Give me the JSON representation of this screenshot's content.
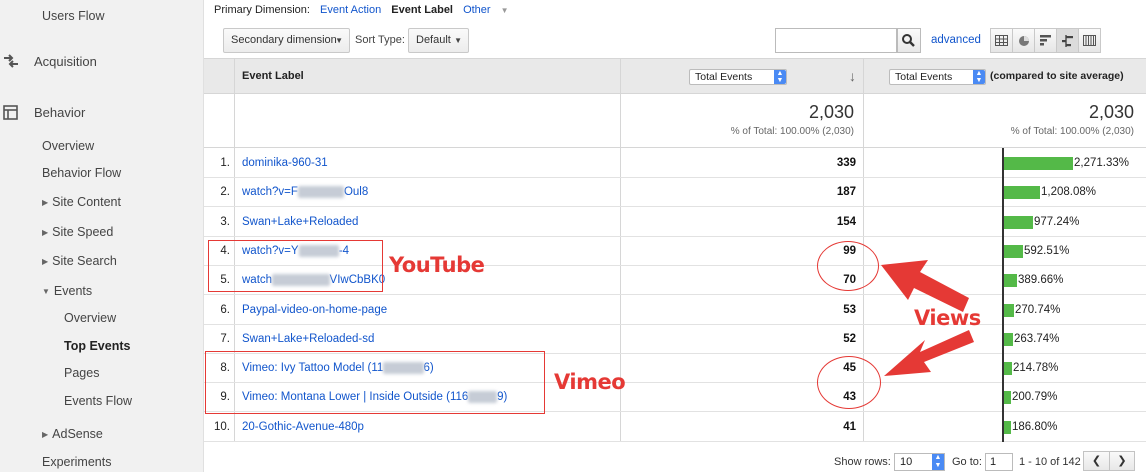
{
  "sidebar": {
    "users_flow": "Users Flow",
    "acquisition": "Acquisition",
    "behavior": "Behavior",
    "overview": "Overview",
    "behavior_flow": "Behavior Flow",
    "site_content": "Site Content",
    "site_speed": "Site Speed",
    "site_search": "Site Search",
    "events": "Events",
    "events_overview": "Overview",
    "top_events": "Top Events",
    "pages": "Pages",
    "events_flow": "Events Flow",
    "adsense": "AdSense",
    "experiments": "Experiments"
  },
  "dimensions": {
    "primary_label": "Primary Dimension:",
    "event_action": "Event Action",
    "event_label": "Event Label",
    "other": "Other"
  },
  "toolbar": {
    "secondary_dimension": "Secondary dimension",
    "sort_type_label": "Sort Type:",
    "sort_type_value": "Default",
    "search_value": "",
    "advanced": "advanced"
  },
  "table": {
    "col_label": "Event Label",
    "metric_select": "Total Events",
    "compare_select": "Total Events",
    "compare_suffix": "(compared to site average)",
    "total_value": "2,030",
    "total_sub": "% of Total: 100.00% (2,030)",
    "total_value_right": "2,030",
    "total_sub_right": "% of Total: 100.00% (2,030)",
    "rows": [
      {
        "idx": "1.",
        "pre": "dominika-960-31",
        "blur": "",
        "post": "",
        "value": "339",
        "pct": "2,271.33%",
        "fraction": 0.232
      },
      {
        "idx": "2.",
        "pre": "watch?v=F",
        "blur": "xxxxxxxx",
        "post": "Oul8",
        "value": "187",
        "pct": "1,208.08%",
        "fraction": 0.123
      },
      {
        "idx": "3.",
        "pre": "Swan+Lake+Reloaded",
        "blur": "",
        "post": "",
        "value": "154",
        "pct": "977.24%",
        "fraction": 0.101
      },
      {
        "idx": "4.",
        "pre": "watch?v=Y",
        "blur": "xxxxxxx",
        "post": "-4",
        "value": "99",
        "pct": "592.51%",
        "fraction": 0.065
      },
      {
        "idx": "5.",
        "pre": "watch",
        "blur": "xxxxxxxxxx",
        "post": "VIwCbBK0",
        "value": "70",
        "pct": "389.66%",
        "fraction": 0.046
      },
      {
        "idx": "6.",
        "pre": "Paypal-video-on-home-page",
        "blur": "",
        "post": "",
        "value": "53",
        "pct": "270.74%",
        "fraction": 0.035
      },
      {
        "idx": "7.",
        "pre": "Swan+Lake+Reloaded-sd",
        "blur": "",
        "post": "",
        "value": "52",
        "pct": "263.74%",
        "fraction": 0.034
      },
      {
        "idx": "8.",
        "pre": "Vimeo: Ivy Tattoo Model (11",
        "blur": "xxxxxxx",
        "post": "6)",
        "value": "45",
        "pct": "214.78%",
        "fraction": 0.029
      },
      {
        "idx": "9.",
        "pre": "Vimeo: Montana Lower | Inside Outside (116",
        "blur": "xxxxx",
        "post": "9)",
        "value": "43",
        "pct": "200.79%",
        "fraction": 0.028
      },
      {
        "idx": "10.",
        "pre": "20-Gothic-Avenue-480p",
        "blur": "",
        "post": "",
        "value": "41",
        "pct": "186.80%",
        "fraction": 0.026
      }
    ]
  },
  "annotations": {
    "youtube": "YouTube",
    "vimeo": "Vimeo",
    "views": "Views",
    "color": "#e53935"
  },
  "footer": {
    "show_rows_label": "Show rows:",
    "show_rows_value": "10",
    "goto_label": "Go to:",
    "goto_value": "1",
    "range": "1 - 10 of 142"
  },
  "colors": {
    "bar": "#54b948",
    "link": "#1155cc",
    "accent_select": "#4a8af4"
  }
}
